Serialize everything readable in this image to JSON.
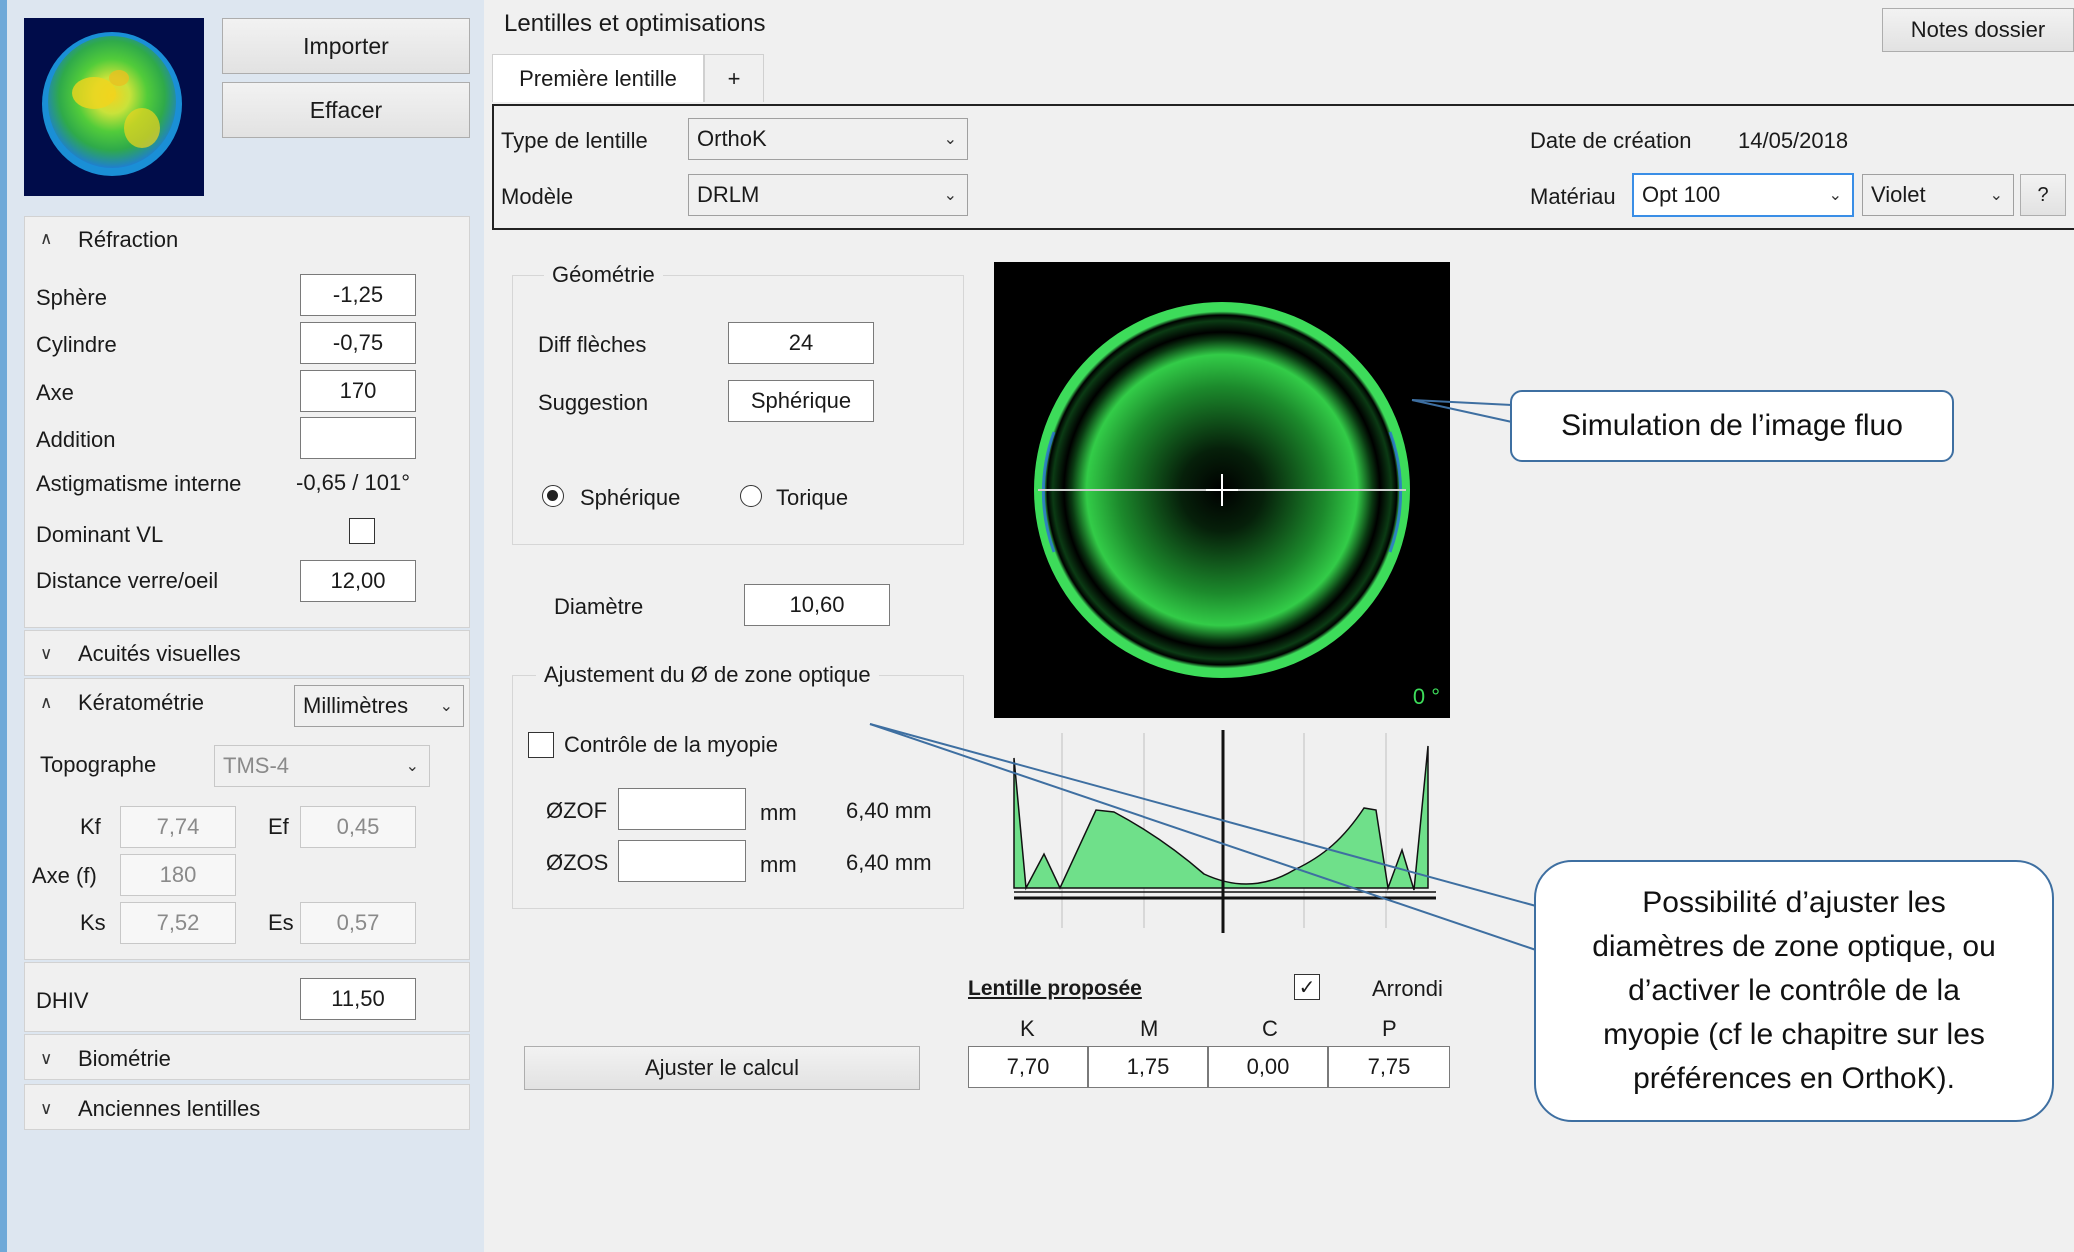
{
  "left": {
    "import_label": "Importer",
    "clear_label": "Effacer",
    "refraction": {
      "title": "Réfraction",
      "sphere_label": "Sphère",
      "sphere_value": "-1,25",
      "cylinder_label": "Cylindre",
      "cylinder_value": "-0,75",
      "axis_label": "Axe",
      "axis_value": "170",
      "addition_label": "Addition",
      "addition_value": "",
      "internal_astig_label": "Astigmatisme interne",
      "internal_astig_value": "-0,65 / 101°",
      "dominant_label": "Dominant VL",
      "dominant_checked": false,
      "distance_label": "Distance verre/oeil",
      "distance_value": "12,00"
    },
    "acuities_title": "Acuités visuelles",
    "keratometry": {
      "title": "Kératométrie",
      "unit": "Millimètres",
      "topographer_label": "Topographe",
      "topographer_value": "TMS-4",
      "kf_label": "Kf",
      "kf_value": "7,74",
      "ef_label": "Ef",
      "ef_value": "0,45",
      "axe_label": "Axe (f)",
      "axe_value": "180",
      "ks_label": "Ks",
      "ks_value": "7,52",
      "es_label": "Es",
      "es_value": "0,57"
    },
    "dhiv_label": "DHIV",
    "dhiv_value": "11,50",
    "biometry_title": "Biométrie",
    "old_lenses_title": "Anciennes lentilles"
  },
  "main": {
    "title": "Lentilles et optimisations",
    "notes_label": "Notes dossier",
    "tabs": [
      {
        "label": "Première lentille"
      },
      {
        "label": "+"
      }
    ],
    "lens_type_label": "Type de lentille",
    "lens_type_value": "OrthoK",
    "model_label": "Modèle",
    "model_value": "DRLM",
    "creation_date_label": "Date de création",
    "creation_date_value": "14/05/2018",
    "material_label": "Matériau",
    "material_value": "Opt 100",
    "color_value": "Violet",
    "help_label": "?",
    "geometry": {
      "title": "Géométrie",
      "diff_label": "Diff flèches",
      "diff_value": "24",
      "suggestion_label": "Suggestion",
      "suggestion_value": "Sphérique",
      "spherical_label": "Sphérique",
      "toric_label": "Torique",
      "selected": "spherical"
    },
    "diameter_label": "Diamètre",
    "diameter_value": "10,60",
    "optical_zone": {
      "title": "Ajustement du Ø de zone optique",
      "myopia_label": "Contrôle de la myopie",
      "myopia_checked": false,
      "zof_label": "ØZOF",
      "zof_unit": "mm",
      "zof_info": "6,40 mm",
      "zos_label": "ØZOS",
      "zos_unit": "mm",
      "zos_info": "6,40 mm"
    },
    "sim_angle": "0 °",
    "proposed": {
      "title": "Lentille proposée",
      "rounding_label": "Arrondi",
      "rounding_checked": true,
      "headers": [
        "K",
        "M",
        "C",
        "P"
      ],
      "values": [
        "7,70",
        "1,75",
        "0,00",
        "7,75"
      ]
    },
    "adjust_label": "Ajuster le calcul"
  },
  "callouts": {
    "fluo": "Simulation de l’image fluo",
    "oz_lines": [
      "Possibilité d’ajuster les",
      "diamètres de zone optique, ou",
      "d’activer le contrôle de la",
      "myopie (cf le chapitre sur les",
      "préférences en OrthoK)."
    ]
  },
  "colors": {
    "fluo_green": "#3ddc5a",
    "profile_fill": "#6fe08a",
    "callout_border": "#3e6fa1",
    "left_panel": "#dde6f0"
  }
}
